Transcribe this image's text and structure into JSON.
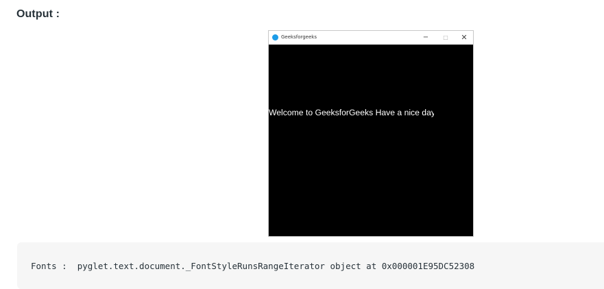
{
  "heading": "Output :",
  "window": {
    "title": "Geeksforgeeks",
    "controls": {
      "minimize": "−",
      "maximize": "□",
      "close": "✕"
    },
    "content_text": "Welcome to GeeksforGeeks Have a nice day"
  },
  "code_output": "Fonts :  pyglet.text.document._FontStyleRunsRangeIterator object at 0x000001E95DC52308",
  "colors": {
    "app_icon": "#1c9ce8",
    "window_background": "#000000",
    "text_on_window": "#ffffff",
    "code_background": "#f6f6f6"
  }
}
